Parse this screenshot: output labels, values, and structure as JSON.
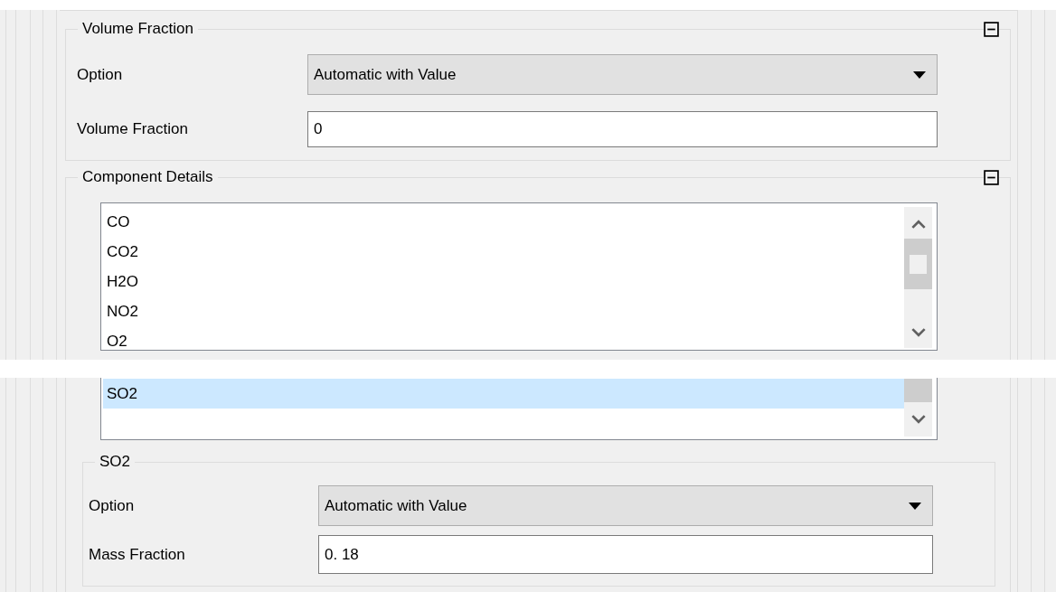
{
  "panel_top": {
    "volume_fraction": {
      "title": "Volume Fraction",
      "rows": [
        {
          "kind": "dropdown",
          "label": "Option",
          "value": "Automatic with Value"
        },
        {
          "kind": "input",
          "label": "Volume Fraction",
          "value": "0"
        }
      ]
    },
    "component_details": {
      "title": "Component Details",
      "items": [
        {
          "label": "CO",
          "selected": false
        },
        {
          "label": "CO2",
          "selected": false
        },
        {
          "label": "H2O",
          "selected": false
        },
        {
          "label": "NO2",
          "selected": false
        },
        {
          "label": "O2",
          "selected": false
        }
      ]
    }
  },
  "panel_bottom": {
    "component_list": {
      "items": [
        {
          "label": "SO2",
          "selected": true
        }
      ]
    },
    "component_group": {
      "title": "SO2",
      "rows": [
        {
          "kind": "dropdown",
          "label": "Option",
          "value": "Automatic with Value"
        },
        {
          "kind": "input",
          "label": "Mass Fraction",
          "value": "0. 18"
        }
      ]
    }
  }
}
